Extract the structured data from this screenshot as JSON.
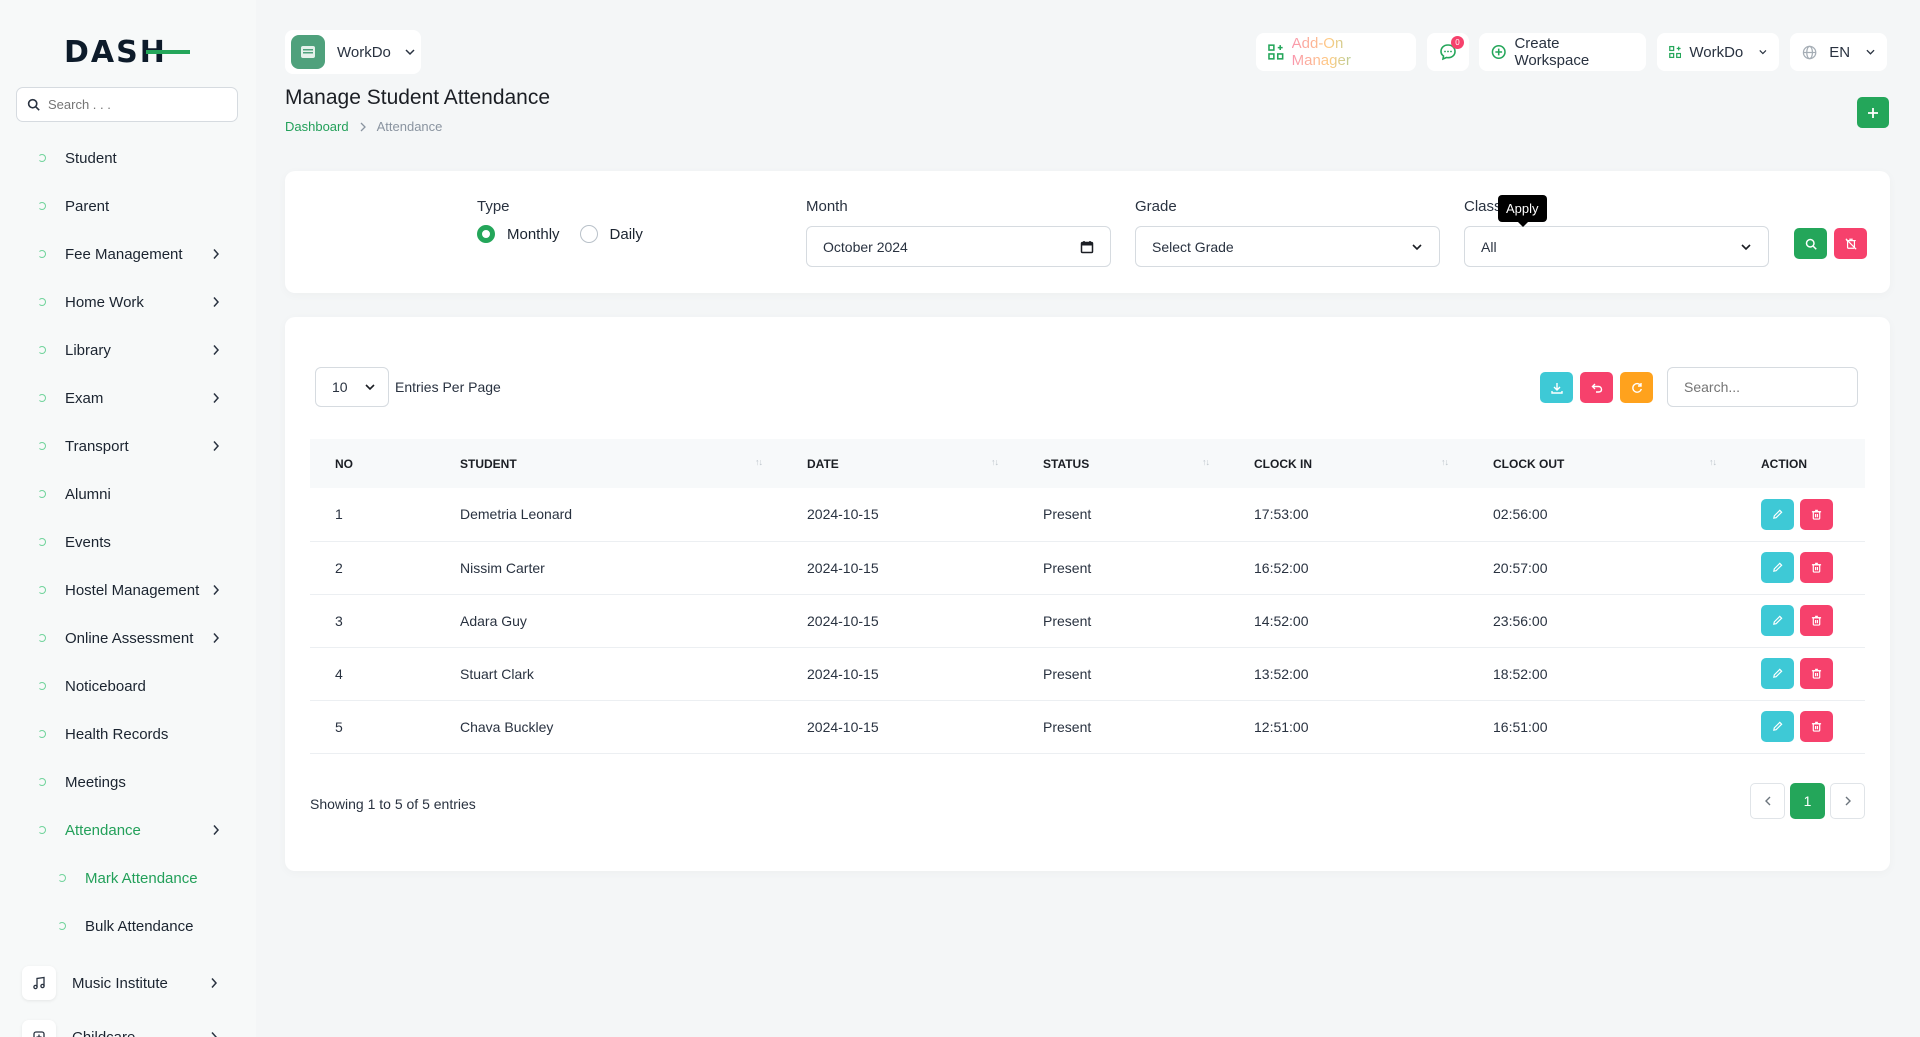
{
  "brand": {
    "logo_text": "DASH"
  },
  "sidebar": {
    "search_placeholder": "Search . . .",
    "items": [
      {
        "label": "Student",
        "has_children": false
      },
      {
        "label": "Parent",
        "has_children": false
      },
      {
        "label": "Fee Management",
        "has_children": true
      },
      {
        "label": "Home Work",
        "has_children": true
      },
      {
        "label": "Library",
        "has_children": true
      },
      {
        "label": "Exam",
        "has_children": true
      },
      {
        "label": "Transport",
        "has_children": true
      },
      {
        "label": "Alumni",
        "has_children": false
      },
      {
        "label": "Events",
        "has_children": false
      },
      {
        "label": "Hostel Management",
        "has_children": true
      },
      {
        "label": "Online Assessment",
        "has_children": true
      },
      {
        "label": "Noticeboard",
        "has_children": false
      },
      {
        "label": "Health Records",
        "has_children": false
      },
      {
        "label": "Meetings",
        "has_children": false
      },
      {
        "label": "Attendance",
        "has_children": true,
        "active": true
      }
    ],
    "sub_items": [
      {
        "label": "Mark Attendance",
        "active": true
      },
      {
        "label": "Bulk Attendance",
        "active": false
      }
    ],
    "modules": [
      {
        "label": "Music Institute",
        "icon": "music-icon"
      },
      {
        "label": "Childcare",
        "icon": "childcare-icon"
      }
    ]
  },
  "topbar": {
    "workspace_name": "WorkDo",
    "addon_manager": "Add-On Manager",
    "messages_count": "0",
    "create_workspace": "Create Workspace",
    "workspace_switch": "WorkDo",
    "language": "EN"
  },
  "page": {
    "title": "Manage Student Attendance",
    "breadcrumb": {
      "home": "Dashboard",
      "current": "Attendance"
    }
  },
  "filters": {
    "type_label": "Type",
    "type_options": [
      "Monthly",
      "Daily"
    ],
    "type_selected": "Monthly",
    "month_label": "Month",
    "month_value": "October 2024",
    "grade_label": "Grade",
    "grade_value": "Select Grade",
    "class_label": "Class",
    "class_value": "All",
    "apply_tooltip": "Apply"
  },
  "table": {
    "entries_per_page": "10",
    "entries_label": "Entries Per Page",
    "search_placeholder": "Search...",
    "columns": [
      "NO",
      "STUDENT",
      "DATE",
      "STATUS",
      "CLOCK IN",
      "CLOCK OUT",
      "ACTION"
    ],
    "rows": [
      {
        "no": "1",
        "student": "Demetria Leonard",
        "date": "2024-10-15",
        "status": "Present",
        "clock_in": "17:53:00",
        "clock_out": "02:56:00"
      },
      {
        "no": "2",
        "student": "Nissim Carter",
        "date": "2024-10-15",
        "status": "Present",
        "clock_in": "16:52:00",
        "clock_out": "20:57:00"
      },
      {
        "no": "3",
        "student": "Adara Guy",
        "date": "2024-10-15",
        "status": "Present",
        "clock_in": "14:52:00",
        "clock_out": "23:56:00"
      },
      {
        "no": "4",
        "student": "Stuart Clark",
        "date": "2024-10-15",
        "status": "Present",
        "clock_in": "13:52:00",
        "clock_out": "18:52:00"
      },
      {
        "no": "5",
        "student": "Chava Buckley",
        "date": "2024-10-15",
        "status": "Present",
        "clock_in": "12:51:00",
        "clock_out": "16:51:00"
      }
    ],
    "showing_text": "Showing 1 to 5 of 5 entries",
    "current_page": "1"
  },
  "colors": {
    "primary": "#24a65a",
    "danger": "#f6416c",
    "info": "#3ec9d6",
    "warning": "#ffa21d"
  }
}
